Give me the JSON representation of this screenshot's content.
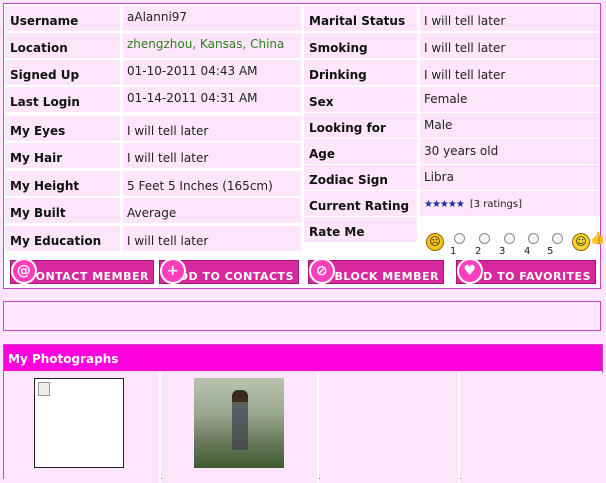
{
  "profile": {
    "left": [
      {
        "label": "Username",
        "value": "aAlanni97",
        "color": "normal"
      },
      {
        "label": "Location",
        "value": "zhengzhou, Kansas, China",
        "color": "#2f7d1f"
      },
      {
        "label": "Signed Up",
        "value": "01-10-2011 04:43 AM",
        "color": "normal"
      },
      {
        "label": "Last Login",
        "value": "01-14-2011 04:31 AM",
        "color": "normal"
      },
      {
        "label": "My Eyes",
        "value": "I will tell later",
        "color": "normal"
      },
      {
        "label": "My Hair",
        "value": "I will tell later",
        "color": "normal"
      },
      {
        "label": "My Height",
        "value": "5 Feet 5 Inches (165cm)",
        "color": "normal"
      },
      {
        "label": "My Built",
        "value": "Average",
        "color": "normal"
      },
      {
        "label": "My Education",
        "value": "I will tell later",
        "color": "normal"
      }
    ],
    "right": [
      {
        "label": "Marital Status",
        "value": "I will tell later"
      },
      {
        "label": "Smoking",
        "value": "I will tell later"
      },
      {
        "label": "Drinking",
        "value": "I will tell later"
      },
      {
        "label": "Sex",
        "value": "Female"
      },
      {
        "label": "Looking for",
        "value": "Male"
      },
      {
        "label": "Age",
        "value": "30 years old"
      },
      {
        "label": "Zodiac Sign",
        "value": "Libra"
      }
    ],
    "current_rating": {
      "label": "Current Rating",
      "stars": "★★★★★",
      "count": "[3 ratings]"
    },
    "rate_me": {
      "label": "Rate Me",
      "options": [
        "1",
        "2",
        "3",
        "4",
        "5"
      ]
    }
  },
  "actions": {
    "contact": "CONTACT MEMBER",
    "add_contacts": "ADD TO CONTACTS",
    "block": "BLOCK MEMBER",
    "favorites": "ADD TO FAVORITES"
  },
  "photos": {
    "header": "My Photographs"
  },
  "colors": {
    "accent": "#ff00dd",
    "button": "#d8289e",
    "panel": "#fde6fb",
    "location_text": "#2f7d1f",
    "stars": "#1a2ca0"
  }
}
